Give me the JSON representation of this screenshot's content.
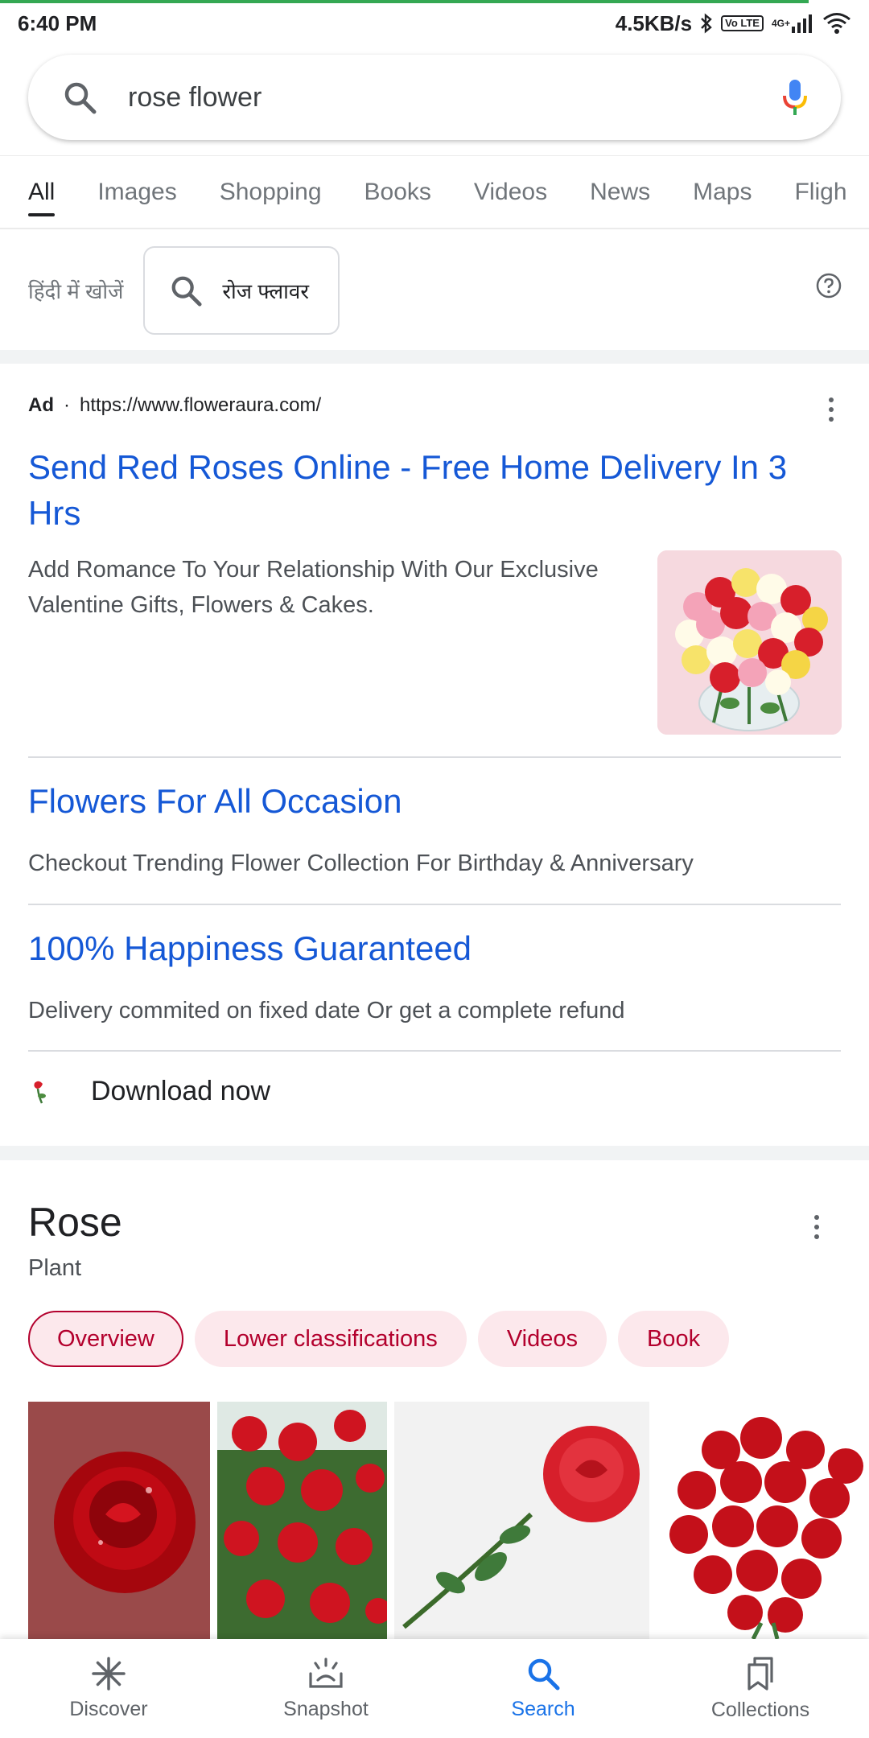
{
  "status_bar": {
    "time": "6:40 PM",
    "network_speed": "4.5KB/s",
    "volte": "Vo LTE",
    "network_type": "4G+"
  },
  "search": {
    "query": "rose flower"
  },
  "tabs": [
    {
      "label": "All",
      "active": true
    },
    {
      "label": "Images"
    },
    {
      "label": "Shopping"
    },
    {
      "label": "Books"
    },
    {
      "label": "Videos"
    },
    {
      "label": "News"
    },
    {
      "label": "Maps"
    },
    {
      "label": "Fligh"
    }
  ],
  "hindi_search": {
    "label": "हिंदी में खोजें",
    "query": "रोज फ्लावर"
  },
  "ad": {
    "badge": "Ad",
    "separator": "·",
    "url": "https://www.floweraura.com/",
    "title": "Send Red Roses Online - Free Home Delivery In 3 Hrs",
    "description": "Add Romance To Your Relationship With Our Exclusive Valentine Gifts, Flowers & Cakes.",
    "sitelinks": [
      {
        "title": "Flowers For All Occasion",
        "description": "Checkout Trending Flower Collection For Birthday & Anniversary"
      },
      {
        "title": "100% Happiness Guaranteed",
        "description": "Delivery commited on fixed date Or get a complete refund"
      }
    ],
    "download_label": "Download now"
  },
  "knowledge_panel": {
    "title": "Rose",
    "subtitle": "Plant",
    "chips": [
      {
        "label": "Overview",
        "active": true
      },
      {
        "label": "Lower classifications"
      },
      {
        "label": "Videos"
      },
      {
        "label": "Book"
      }
    ]
  },
  "bottom_nav": [
    {
      "label": "Discover",
      "icon": "asterisk-icon"
    },
    {
      "label": "Snapshot",
      "icon": "snapshot-icon"
    },
    {
      "label": "Search",
      "icon": "search-icon",
      "active": true
    },
    {
      "label": "Collections",
      "icon": "bookmarks-icon"
    }
  ],
  "colors": {
    "link_blue": "#1558d6",
    "chip_red": "#b3002d",
    "chip_bg": "#fce8ec",
    "active_nav": "#1a73e8",
    "progress_green": "#34a853"
  }
}
